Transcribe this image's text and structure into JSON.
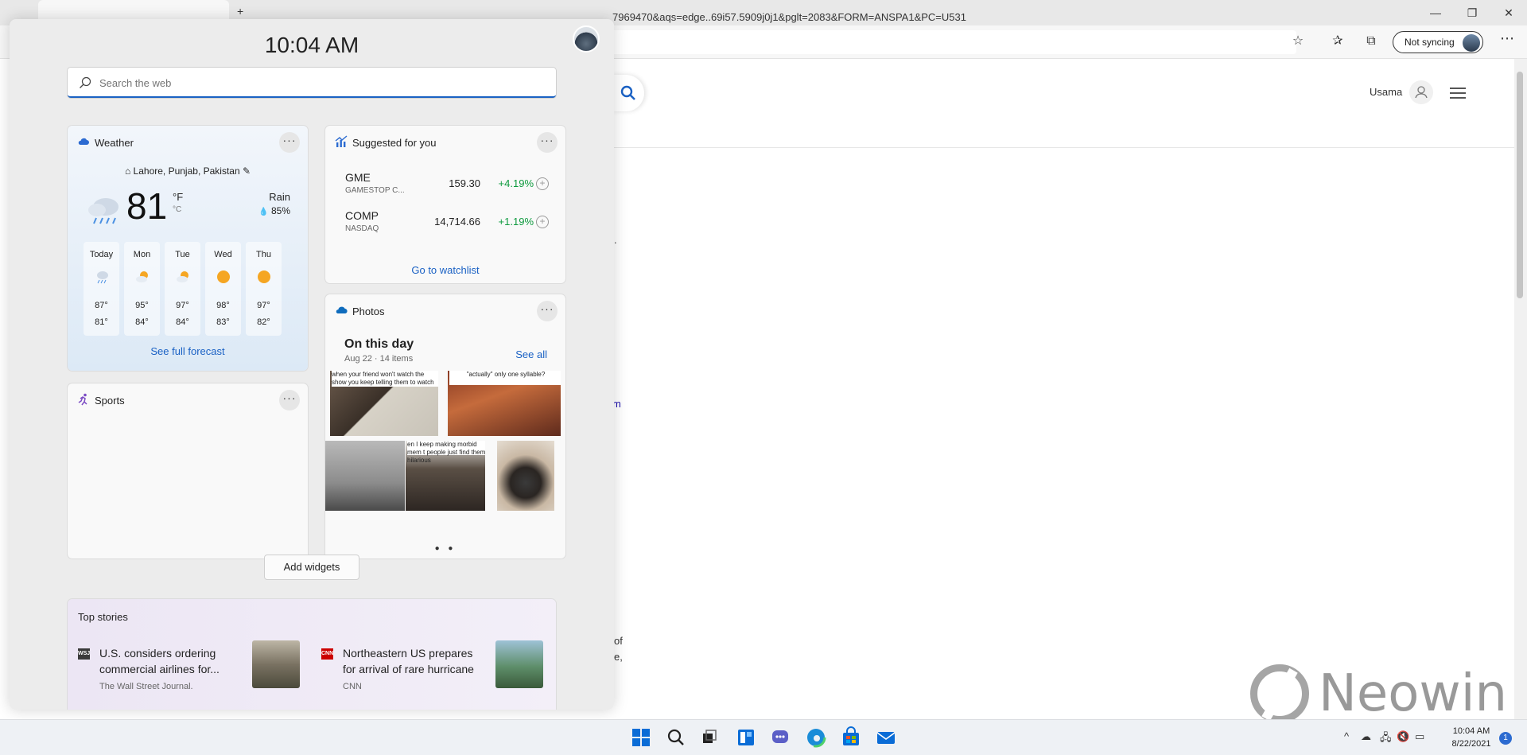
{
  "browser": {
    "url": "7969470&aqs=edge..69i57.5909j0j1&pglt=2083&FORM=ANSPA1&PC=U531",
    "sync_label": "Not syncing",
    "new_tab": "+",
    "user_name": "Usama",
    "fragments": [
      ".",
      "m",
      "of",
      "e,"
    ],
    "watermark": "Neowin"
  },
  "panel": {
    "time": "10:04 AM",
    "search_placeholder": "Search the web",
    "add_widgets": "Add widgets"
  },
  "weather": {
    "title": "Weather",
    "location": "Lahore, Punjab, Pakistan",
    "temp": "81",
    "unit_f": "°F",
    "unit_c": "°C",
    "condition": "Rain",
    "precip": "85%",
    "forecast": [
      {
        "day": "Today",
        "hi": "87°",
        "lo": "81°",
        "icon": "rain-icon"
      },
      {
        "day": "Mon",
        "hi": "95°",
        "lo": "84°",
        "icon": "partly-sunny-icon"
      },
      {
        "day": "Tue",
        "hi": "97°",
        "lo": "84°",
        "icon": "partly-sunny-icon"
      },
      {
        "day": "Wed",
        "hi": "98°",
        "lo": "83°",
        "icon": "sun-icon"
      },
      {
        "day": "Thu",
        "hi": "97°",
        "lo": "82°",
        "icon": "sun-icon"
      }
    ],
    "link": "See full forecast"
  },
  "suggested": {
    "title": "Suggested for you",
    "stocks": [
      {
        "symbol": "GME",
        "name": "GAMESTOP C...",
        "price": "159.30",
        "change": "+4.19%"
      },
      {
        "symbol": "COMP",
        "name": "NASDAQ",
        "price": "14,714.66",
        "change": "+1.19%"
      }
    ],
    "link": "Go to watchlist",
    "positive_color": "#0e9a3e"
  },
  "sports": {
    "title": "Sports"
  },
  "photos": {
    "title": "Photos",
    "heading": "On this day",
    "sub": "Aug 22 · 14 items",
    "see_all": "See all",
    "captions": [
      "when your friend won't watch the show you keep telling them to watch",
      "\"actually\" only one syllable?",
      "en I keep making morbid mem t people just find them hilarious"
    ]
  },
  "stories": {
    "title": "Top stories",
    "items": [
      {
        "source_badge": "WSJ",
        "headline": "U.S. considers ordering commercial airlines for...",
        "publisher": "The Wall Street Journal."
      },
      {
        "source_badge": "CNN",
        "headline": "Northeastern US prepares for arrival of rare hurricane",
        "publisher": "CNN"
      }
    ]
  },
  "taskbar": {
    "time": "10:04 AM",
    "date": "8/22/2021",
    "notifications": "1"
  },
  "colors": {
    "accent": "#1a61c4",
    "panel_bg": "#ececec"
  }
}
